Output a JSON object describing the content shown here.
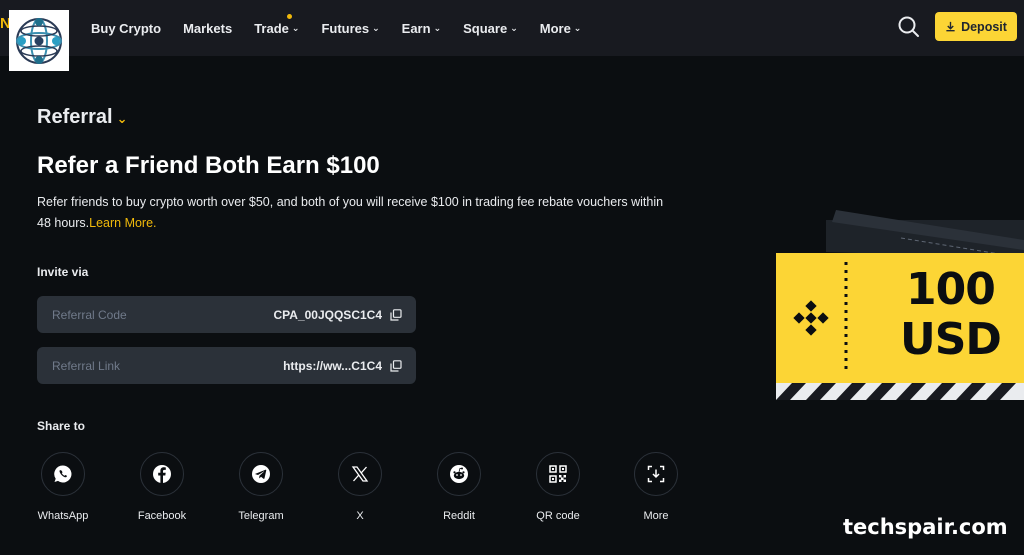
{
  "header": {
    "nav": [
      {
        "label": "Buy Crypto",
        "has_menu": false
      },
      {
        "label": "Markets",
        "has_menu": false
      },
      {
        "label": "Trade",
        "has_menu": true,
        "badge_dot": true
      },
      {
        "label": "Futures",
        "has_menu": true
      },
      {
        "label": "Earn",
        "has_menu": true
      },
      {
        "label": "Square",
        "has_menu": true
      },
      {
        "label": "More",
        "has_menu": true
      }
    ],
    "deposit_label": "Deposit",
    "logo_edge_letter": "N"
  },
  "page": {
    "section_dropdown": "Referral",
    "title": "Refer a Friend Both Earn $100",
    "description": "Refer friends to buy crypto worth over $50, and both of you will receive $100 in trading fee rebate vouchers within 48 hours.",
    "learn_more": "Learn More."
  },
  "invite": {
    "label": "Invite via",
    "referral_code_label": "Referral Code",
    "referral_code_value": "CPA_00JQQSC1C4",
    "referral_link_label": "Referral Link",
    "referral_link_value": "https://ww...C1C4"
  },
  "share": {
    "label": "Share to",
    "items": [
      {
        "label": "WhatsApp",
        "icon": "whatsapp-icon"
      },
      {
        "label": "Facebook",
        "icon": "facebook-icon"
      },
      {
        "label": "Telegram",
        "icon": "telegram-icon"
      },
      {
        "label": "X",
        "icon": "x-icon"
      },
      {
        "label": "Reddit",
        "icon": "reddit-icon"
      },
      {
        "label": "QR code",
        "icon": "qr-code-icon"
      },
      {
        "label": "More",
        "icon": "more-share-icon"
      }
    ]
  },
  "promo": {
    "amount": "100",
    "currency": "USD"
  },
  "watermark": "techspair.com",
  "colors": {
    "accent": "#f0b90b",
    "deposit": "#fcd535",
    "background": "#0b0e11",
    "header": "#181a20",
    "field": "#2b3139"
  }
}
